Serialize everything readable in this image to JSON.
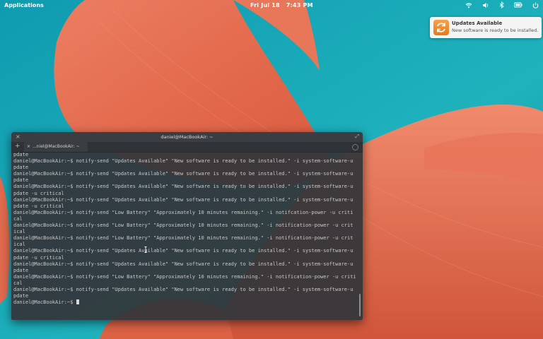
{
  "panel": {
    "applications": "Applications",
    "date": "Fri Jul 18",
    "time": "7:43 PM"
  },
  "notification": {
    "icon": "system-software-update-icon",
    "title": "Updates Available",
    "body": "New software is ready to be installed."
  },
  "terminal": {
    "title": "daniel@MacBookAir: ~",
    "tab_label": "...niel@MacBookAir: ~",
    "lines": [
      "pdate",
      "daniel@MacBookAir:~$ notify-send \"Updates Available\" \"New software is ready to be installed.\" -i system-software-u",
      "pdate",
      "daniel@MacBookAir:~$ notify-send \"Updates Available\" \"New software is ready to be installed.\" -i system-software-u",
      "pdate",
      "daniel@MacBookAir:~$ notify-send \"Updates Available\" \"New software is ready to be installed.\" -i system-software-u",
      "pdate -u critical",
      "daniel@MacBookAir:~$ notify-send \"Updates Available\" \"New software is ready to be installed.\" -i system-software-u",
      "pdate -u critical",
      "daniel@MacBookAir:~$ notify-send \"Low Battery\" \"Approximately 10 minutes remaining.\" -i notifcation-power -u criti",
      "cal",
      "daniel@MacBookAir:~$ notify-send \"Low Battery\" \"Approximately 10 minutes remaining.\" -i notification-power -u crit",
      "ical",
      "daniel@MacBookAir:~$ notify-send \"Low Battery\" \"Approximately 10 minutes remaining.\" -i notification-power -u crit",
      "ical",
      "daniel@MacBookAir:~$ notify-send \"Updates Available\" \"New software is ready to be installed.\" -i system-software-u",
      "pdate -u critical",
      "daniel@MacBookAir:~$ notify-send \"Updates Available\" \"New software is ready to be installed.\" -i system-software-u",
      "pdate",
      "daniel@MacBookAir:~$ notify-send \"Low Battery\" \"Approximately 10 minutes remaining.\" -i notification-power -u criti",
      "cal",
      "daniel@MacBookAir:~$ notify-send \"Updates Available\" \"New software is ready to be installed.\" -i system-software-u",
      "pdate"
    ],
    "prompt": "daniel@MacBookAir:~$ "
  },
  "tray_icons": [
    "network-wireless-icon",
    "volume-icon",
    "bluetooth-icon",
    "battery-icon",
    "power-icon"
  ]
}
